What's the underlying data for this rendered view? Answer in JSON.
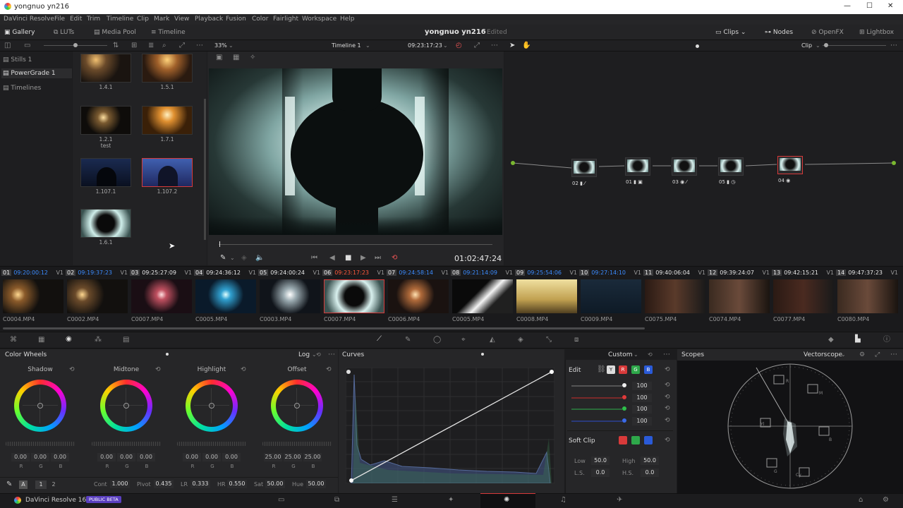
{
  "window": {
    "title": "yongnuo yn216",
    "min": "—",
    "max": "☐",
    "close": "✕"
  },
  "menu": [
    "DaVinci Resolve",
    "File",
    "Edit",
    "Trim",
    "Timeline",
    "Clip",
    "Mark",
    "View",
    "Playback",
    "Fusion",
    "Color",
    "Fairlight",
    "Workspace",
    "Help"
  ],
  "toolbar": {
    "gallery": "Gallery",
    "luts": "LUTs",
    "media_pool": "Media Pool",
    "timeline": "Timeline",
    "project": "yongnuo yn216",
    "status": "Edited",
    "clips": "Clips",
    "nodes": "Nodes",
    "openfx": "OpenFX",
    "lightbox": "Lightbox"
  },
  "viewer": {
    "zoom": "33%",
    "timeline_name": "Timeline 1",
    "timecode": "09:23:17:23",
    "playhead": "01:02:47:24"
  },
  "nodes_header": {
    "mode": "Clip"
  },
  "gallery": {
    "sidebar": [
      "Stills 1",
      "PowerGrade 1",
      "Timelines"
    ],
    "stills": [
      {
        "label": "1.4.1",
        "sub": ""
      },
      {
        "label": "1.5.1",
        "sub": ""
      },
      {
        "label": "1.2.1",
        "sub": "test"
      },
      {
        "label": "1.7.1",
        "sub": ""
      },
      {
        "label": "1.107.1",
        "sub": ""
      },
      {
        "label": "1.107.2",
        "sub": ""
      },
      {
        "label": "1.6.1",
        "sub": ""
      }
    ]
  },
  "nodes": [
    {
      "id": "02",
      "icons": "▮ ⁄"
    },
    {
      "id": "01",
      "icons": "▮ ▣"
    },
    {
      "id": "03",
      "icons": "◉ ⁄"
    },
    {
      "id": "05",
      "icons": "▮ ◷"
    },
    {
      "id": "04",
      "icons": "◉"
    }
  ],
  "clips": [
    {
      "num": "01",
      "tc": "09:20:00:12",
      "tc_color": "#3c8cff",
      "track": "V1",
      "name": "C0004.MP4"
    },
    {
      "num": "02",
      "tc": "09:19:37:23",
      "tc_color": "#3c8cff",
      "track": "V1",
      "name": "C0002.MP4"
    },
    {
      "num": "03",
      "tc": "09:25:27:09",
      "tc_color": "#e6e6e6",
      "track": "V1",
      "name": "C0007.MP4"
    },
    {
      "num": "04",
      "tc": "09:24:36:12",
      "tc_color": "#e6e6e6",
      "track": "V1",
      "name": "C0005.MP4"
    },
    {
      "num": "05",
      "tc": "09:24:00:24",
      "tc_color": "#e6e6e6",
      "track": "V1",
      "name": "C0003.MP4"
    },
    {
      "num": "06",
      "tc": "09:23:17:23",
      "tc_color": "#ff5a3c",
      "track": "V1",
      "name": "C0007.MP4"
    },
    {
      "num": "07",
      "tc": "09:24:58:14",
      "tc_color": "#3c8cff",
      "track": "V1",
      "name": "C0006.MP4"
    },
    {
      "num": "08",
      "tc": "09:21:14:09",
      "tc_color": "#3c8cff",
      "track": "V1",
      "name": "C0005.MP4"
    },
    {
      "num": "09",
      "tc": "09:25:54:06",
      "tc_color": "#3c8cff",
      "track": "V1",
      "name": "C0008.MP4"
    },
    {
      "num": "10",
      "tc": "09:27:14:10",
      "tc_color": "#3c8cff",
      "track": "V1",
      "name": "C0009.MP4"
    },
    {
      "num": "11",
      "tc": "09:40:06:04",
      "tc_color": "#e6e6e6",
      "track": "V1",
      "name": "C0075.MP4"
    },
    {
      "num": "12",
      "tc": "09:39:24:07",
      "tc_color": "#e6e6e6",
      "track": "V1",
      "name": "C0074.MP4"
    },
    {
      "num": "13",
      "tc": "09:42:15:21",
      "tc_color": "#e6e6e6",
      "track": "V1",
      "name": "C0077.MP4"
    },
    {
      "num": "14",
      "tc": "09:47:37:23",
      "tc_color": "#e6e6e6",
      "track": "V1",
      "name": "C0080.MP4"
    }
  ],
  "color_wheels": {
    "title": "Color Wheels",
    "mode": "Log",
    "wheels": [
      {
        "name": "Shadow",
        "values": [
          "0.00",
          "0.00",
          "0.00"
        ]
      },
      {
        "name": "Midtone",
        "values": [
          "0.00",
          "0.00",
          "0.00"
        ]
      },
      {
        "name": "Highlight",
        "values": [
          "0.00",
          "0.00",
          "0.00"
        ]
      },
      {
        "name": "Offset",
        "values": [
          "25.00",
          "25.00",
          "25.00"
        ]
      }
    ],
    "channel_labels": [
      "R",
      "G",
      "B"
    ],
    "footer": {
      "page_a": "A",
      "page1": "1",
      "page2": "2",
      "cont_label": "Cont",
      "cont": "1.000",
      "pivot_label": "Pivot",
      "pivot": "0.435",
      "lr_label": "LR",
      "lr": "0.333",
      "hr_label": "HR",
      "hr": "0.550",
      "sat_label": "Sat",
      "sat": "50.00",
      "hue_label": "Hue",
      "hue": "50.00"
    }
  },
  "curves": {
    "title": "Curves",
    "mode": "Custom"
  },
  "edit": {
    "title": "Edit",
    "channels": [
      "Y",
      "R",
      "G",
      "B"
    ],
    "values": [
      "100",
      "100",
      "100",
      "100"
    ],
    "soft_clip": "Soft Clip",
    "low_label": "Low",
    "low": "50.0",
    "high_label": "High",
    "high": "50.0",
    "ls_label": "L.S.",
    "ls": "0.0",
    "hs_label": "H.S.",
    "hs": "0.0"
  },
  "scopes": {
    "title": "Scopes",
    "mode": "Vectorscope",
    "targets": [
      "R",
      "M",
      "B",
      "Cy",
      "G",
      "Yl"
    ]
  },
  "footer": {
    "app": "DaVinci Resolve 16",
    "badge": "PUBLIC BETA"
  },
  "colors": {
    "accent_red": "#d83a3a",
    "accent_blue": "#3c8cff",
    "badge_purple": "#5a3fc0"
  }
}
